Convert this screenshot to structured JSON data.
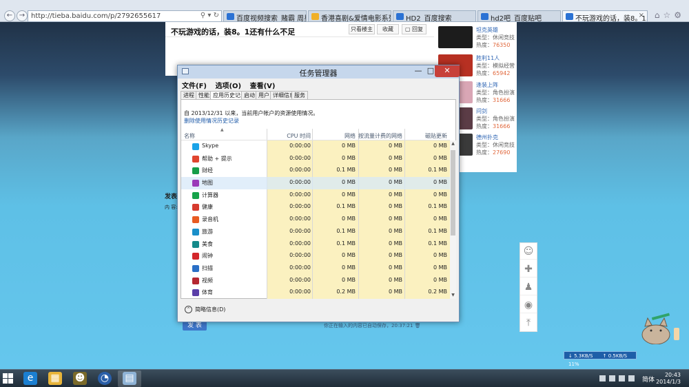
{
  "browser": {
    "url": "http://tieba.baidu.com/p/2792655617",
    "tabs": [
      {
        "label": "百度视频搜索_赌霸 周星...",
        "color": "#2b72d4"
      },
      {
        "label": "香港喜剧&爱情电影系列...",
        "color": "#f0b028"
      },
      {
        "label": "HD2_百度搜索",
        "color": "#2b72d4"
      },
      {
        "label": "hd2吧_百度贴吧",
        "color": "#2b72d4"
      },
      {
        "label": "不玩游戏的话，装8。1...",
        "color": "#2b72d4"
      }
    ]
  },
  "post": {
    "title": "不玩游戏的话，装8。1还有什么不足",
    "buttons": [
      "只看楼主",
      "收藏",
      "回复"
    ],
    "reply_label": "发表",
    "content_label": "内 容:",
    "submit_label": "发 表",
    "autosave": "你正在输入的内容已自动保存，20:37:21"
  },
  "games": [
    {
      "name": "坦克英雄",
      "type": "类型：休闲竞技",
      "heat_label": "热度：",
      "heat": "76350",
      "color": "#1c1c1c"
    },
    {
      "name": "胜利11人",
      "type": "类型：模拟经营",
      "heat_label": "热度：",
      "heat": "65942",
      "color": "#b73022"
    },
    {
      "name": "逢装上阵",
      "type": "类型：角色扮演",
      "heat_label": "热度：",
      "heat": "31666",
      "color": "#d9a6b5"
    },
    {
      "name": "问剑",
      "type": "类型：角色扮演",
      "heat_label": "热度：",
      "heat": "31666",
      "color": "#5b3c46"
    },
    {
      "name": "德州扑克",
      "type": "类型：休闲竞技",
      "heat_label": "热度：",
      "heat": "27690",
      "color": "#3a3a3a"
    }
  ],
  "taskmgr": {
    "title": "任务管理器",
    "menu": [
      "文件(F)",
      "选项(O)",
      "查看(V)"
    ],
    "tabs": [
      "进程",
      "性能",
      "应用历史记录",
      "启动",
      "用户",
      "详细信息",
      "服务"
    ],
    "active_tab": 2,
    "info": "自 2013/12/31 以来，当前用户帐户的资源使用情况。",
    "delete_link": "删除使用情况历史记录",
    "columns": [
      "名称",
      "CPU 时间",
      "网络",
      "按流量计费的网络",
      "磁贴更新"
    ],
    "rows": [
      {
        "name": "Skype",
        "icon": "#1aa3e8",
        "cpu": "0:00:00",
        "net": "0 MB",
        "metered": "0 MB",
        "tile": "0 MB"
      },
      {
        "name": "帮助 + 提示",
        "icon": "#e0452f",
        "cpu": "0:00:00",
        "net": "0 MB",
        "metered": "0 MB",
        "tile": "0 MB"
      },
      {
        "name": "财经",
        "icon": "#169d48",
        "cpu": "0:00:00",
        "net": "0.1 MB",
        "metered": "0 MB",
        "tile": "0.1 MB"
      },
      {
        "name": "地图",
        "icon": "#9b3ab8",
        "cpu": "0:00:00",
        "net": "0 MB",
        "metered": "0 MB",
        "tile": "0 MB"
      },
      {
        "name": "计算器",
        "icon": "#16a34a",
        "cpu": "0:00:00",
        "net": "0 MB",
        "metered": "0 MB",
        "tile": "0 MB"
      },
      {
        "name": "健康",
        "icon": "#d63a2e",
        "cpu": "0:00:00",
        "net": "0.1 MB",
        "metered": "0 MB",
        "tile": "0.1 MB"
      },
      {
        "name": "录音机",
        "icon": "#e85b22",
        "cpu": "0:00:00",
        "net": "0 MB",
        "metered": "0 MB",
        "tile": "0 MB"
      },
      {
        "name": "旅游",
        "icon": "#1a8fc9",
        "cpu": "0:00:00",
        "net": "0.1 MB",
        "metered": "0 MB",
        "tile": "0.1 MB"
      },
      {
        "name": "美食",
        "icon": "#148a8a",
        "cpu": "0:00:00",
        "net": "0.1 MB",
        "metered": "0 MB",
        "tile": "0.1 MB"
      },
      {
        "name": "闹钟",
        "icon": "#d3272b",
        "cpu": "0:00:00",
        "net": "0 MB",
        "metered": "0 MB",
        "tile": "0 MB"
      },
      {
        "name": "扫描",
        "icon": "#2a6fc6",
        "cpu": "0:00:00",
        "net": "0 MB",
        "metered": "0 MB",
        "tile": "0 MB"
      },
      {
        "name": "视频",
        "icon": "#b52731",
        "cpu": "0:00:00",
        "net": "0 MB",
        "metered": "0 MB",
        "tile": "0 MB"
      },
      {
        "name": "体育",
        "icon": "#5a3ea8",
        "cpu": "0:00:00",
        "net": "0.2 MB",
        "metered": "0 MB",
        "tile": "0.2 MB"
      }
    ],
    "selected_row": 3,
    "footer": "简略信息(D)"
  },
  "netspeed": {
    "down": "5.3KB/S",
    "up": "0.5KB/S",
    "pct": "11%"
  },
  "taskbar": {
    "lang": "简体",
    "time": "20:43",
    "date": "2014/1/3"
  }
}
